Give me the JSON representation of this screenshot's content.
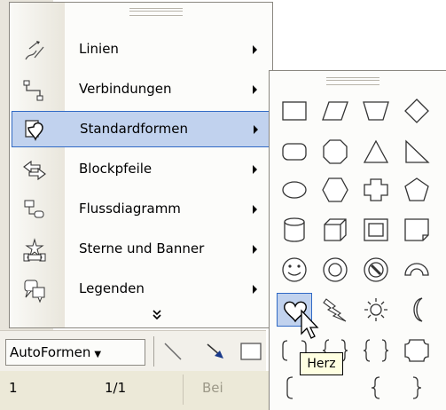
{
  "autoformen_menu": {
    "items": [
      {
        "label": "Linien",
        "icon": "lines-icon"
      },
      {
        "label": "Verbindungen",
        "icon": "connectors-icon"
      },
      {
        "label": "Standardformen",
        "icon": "basic-shapes-icon",
        "selected": true
      },
      {
        "label": "Blockpfeile",
        "icon": "block-arrows-icon"
      },
      {
        "label": "Flussdiagramm",
        "icon": "flowchart-icon"
      },
      {
        "label": "Sterne und Banner",
        "icon": "stars-banners-icon"
      },
      {
        "label": "Legenden",
        "icon": "callouts-icon"
      }
    ],
    "more_indicator": "»"
  },
  "shapes_palette": {
    "shapes": [
      "rectangle",
      "parallelogram",
      "trapezoid",
      "diamond",
      "rounded-rectangle",
      "octagon",
      "triangle",
      "right-triangle",
      "oval",
      "hexagon",
      "cross",
      "pentagon",
      "can",
      "cube",
      "bevel",
      "folded-corner",
      "smiley",
      "donut",
      "no-symbol",
      "block-arc",
      "heart",
      "lightning-bolt",
      "sun",
      "moon",
      "double-bracket",
      "double-brace",
      "brace-pair",
      "plaque",
      "left-bracket",
      "",
      "left-brace",
      "right-brace"
    ],
    "selected_shape": "heart",
    "tooltip": "Herz"
  },
  "drawing_toolbar": {
    "autoformen_label": "AutoFormen",
    "tools": [
      "line-tool",
      "arrow-tool",
      "rectangle-tool"
    ]
  },
  "status_bar": {
    "page": "1",
    "pages": "1/1",
    "position": "Bei"
  },
  "colors": {
    "highlight_fill": "#c1d2ee",
    "highlight_border": "#316ac5",
    "tooltip_bg": "#ffffe1"
  }
}
